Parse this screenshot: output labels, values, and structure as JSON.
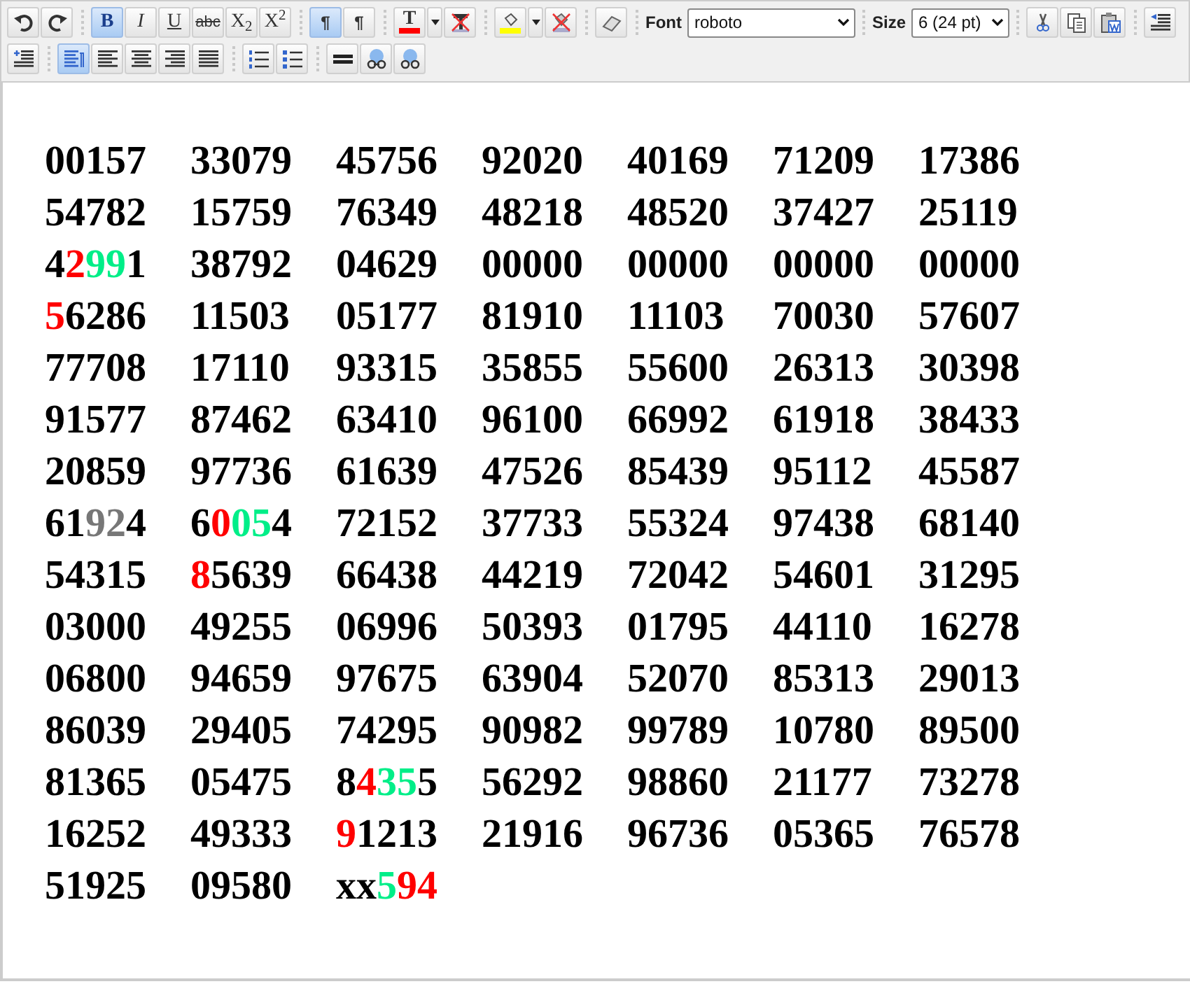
{
  "toolbar": {
    "rows": [
      [
        {
          "kind": "undo"
        },
        {
          "kind": "redo"
        },
        {
          "kind": "separator"
        },
        {
          "kind": "bold",
          "label": "B",
          "selected": true
        },
        {
          "kind": "italic",
          "label": "I",
          "selected": false
        },
        {
          "kind": "underline",
          "label": "U",
          "selected": false
        },
        {
          "kind": "strike",
          "label": "abc",
          "selected": false
        },
        {
          "kind": "script",
          "label": "X$_{2}$",
          "selected": false
        },
        {
          "kind": "script",
          "label": "X$^{2}$",
          "selected": false
        },
        {
          "kind": "separator"
        },
        {
          "kind": "ltr",
          "label": "¶",
          "selected": true
        },
        {
          "kind": "rtl",
          "label": "¶",
          "selected": false
        },
        {
          "kind": "separator"
        },
        {
          "kind": "forecolor",
          "label": "T",
          "color": "#ff0000"
        },
        {
          "kind": "caret"
        },
        {
          "kind": "remove-forecolor"
        },
        {
          "kind": "separator"
        },
        {
          "kind": "backcolor",
          "color": "#ffff00"
        },
        {
          "kind": "caret"
        },
        {
          "kind": "remove-backcolor"
        },
        {
          "kind": "separator"
        },
        {
          "kind": "eraser"
        },
        {
          "kind": "separator"
        },
        {
          "kind": "select",
          "label": "Font",
          "value": "roboto"
        },
        {
          "kind": "separator"
        },
        {
          "kind": "select",
          "label": "Size",
          "value": "6 (24 pt)"
        },
        {
          "kind": "separator"
        },
        {
          "kind": "cut"
        },
        {
          "kind": "copy"
        },
        {
          "kind": "paste-word"
        },
        {
          "kind": "separator"
        },
        {
          "kind": "outdent"
        }
      ],
      [
        {
          "kind": "indent"
        },
        {
          "kind": "separator"
        },
        {
          "kind": "align-para",
          "selected": true
        },
        {
          "kind": "align-left",
          "selected": false
        },
        {
          "kind": "align-center",
          "selected": false
        },
        {
          "kind": "align-right",
          "selected": false
        },
        {
          "kind": "align-justify",
          "selected": false
        },
        {
          "kind": "separator"
        },
        {
          "kind": "ordered-list"
        },
        {
          "kind": "bullet-list"
        },
        {
          "kind": "separator"
        },
        {
          "kind": "rule"
        },
        {
          "kind": "link"
        },
        {
          "kind": "unlink"
        }
      ]
    ]
  },
  "editor": {
    "rows": [
      [
        [
          {
            "text": "00157"
          }
        ],
        [
          {
            "text": "33079"
          }
        ],
        [
          {
            "text": "45756"
          }
        ],
        [
          {
            "text": "92020"
          }
        ],
        [
          {
            "text": "40169"
          }
        ],
        [
          {
            "text": "71209"
          }
        ],
        [
          {
            "text": "17386"
          }
        ]
      ],
      [
        [
          {
            "text": "54782"
          }
        ],
        [
          {
            "text": "15759"
          }
        ],
        [
          {
            "text": "76349"
          }
        ],
        [
          {
            "text": "48218"
          }
        ],
        [
          {
            "text": "48520"
          }
        ],
        [
          {
            "text": "37427"
          }
        ],
        [
          {
            "text": "25119"
          }
        ]
      ],
      [
        [
          {
            "text": "4"
          },
          {
            "text": "2",
            "color": "#ff0000"
          },
          {
            "text": "99",
            "color": "#00ee88"
          },
          {
            "text": "1"
          }
        ],
        [
          {
            "text": "38792"
          }
        ],
        [
          {
            "text": "04629"
          }
        ],
        [
          {
            "text": "00000"
          }
        ],
        [
          {
            "text": "00000"
          }
        ],
        [
          {
            "text": "00000"
          }
        ],
        [
          {
            "text": "00000"
          }
        ]
      ],
      [
        [
          {
            "text": "5",
            "color": "#ff0000"
          },
          {
            "text": "6286"
          }
        ],
        [
          {
            "text": "11503"
          }
        ],
        [
          {
            "text": "05177"
          }
        ],
        [
          {
            "text": "81910"
          }
        ],
        [
          {
            "text": "11103"
          }
        ],
        [
          {
            "text": "70030"
          }
        ],
        [
          {
            "text": "57607"
          }
        ]
      ],
      [
        [
          {
            "text": "77708"
          }
        ],
        [
          {
            "text": "17110"
          }
        ],
        [
          {
            "text": "93315"
          }
        ],
        [
          {
            "text": "35855"
          }
        ],
        [
          {
            "text": "55600"
          }
        ],
        [
          {
            "text": "26313"
          }
        ],
        [
          {
            "text": "30398"
          }
        ]
      ],
      [
        [
          {
            "text": "91577"
          }
        ],
        [
          {
            "text": "87462"
          }
        ],
        [
          {
            "text": "63410"
          }
        ],
        [
          {
            "text": "96100"
          }
        ],
        [
          {
            "text": "66992"
          }
        ],
        [
          {
            "text": "61918"
          }
        ],
        [
          {
            "text": "38433"
          }
        ]
      ],
      [
        [
          {
            "text": "20859"
          }
        ],
        [
          {
            "text": "97736"
          }
        ],
        [
          {
            "text": "61639"
          }
        ],
        [
          {
            "text": "47526"
          }
        ],
        [
          {
            "text": "85439"
          }
        ],
        [
          {
            "text": "95112"
          }
        ],
        [
          {
            "text": "45587"
          }
        ]
      ],
      [
        [
          {
            "text": "61"
          },
          {
            "text": "92",
            "color": "#777777"
          },
          {
            "text": "4"
          }
        ],
        [
          {
            "text": "6"
          },
          {
            "text": "0",
            "color": "#ff0000"
          },
          {
            "text": "05",
            "color": "#00ee88"
          },
          {
            "text": "4"
          }
        ],
        [
          {
            "text": "72152"
          }
        ],
        [
          {
            "text": "37733"
          }
        ],
        [
          {
            "text": "55324"
          }
        ],
        [
          {
            "text": "97438"
          }
        ],
        [
          {
            "text": "68140"
          }
        ]
      ],
      [
        [
          {
            "text": "54315"
          }
        ],
        [
          {
            "text": "8",
            "color": "#ff0000"
          },
          {
            "text": "5639"
          }
        ],
        [
          {
            "text": "66438"
          }
        ],
        [
          {
            "text": "44219"
          }
        ],
        [
          {
            "text": "72042"
          }
        ],
        [
          {
            "text": "54601"
          }
        ],
        [
          {
            "text": "31295"
          }
        ]
      ],
      [
        [
          {
            "text": "03000"
          }
        ],
        [
          {
            "text": "49255"
          }
        ],
        [
          {
            "text": "06996"
          }
        ],
        [
          {
            "text": "50393"
          }
        ],
        [
          {
            "text": "01795"
          }
        ],
        [
          {
            "text": "44110"
          }
        ],
        [
          {
            "text": "16278"
          }
        ]
      ],
      [
        [
          {
            "text": "06800"
          }
        ],
        [
          {
            "text": "94659"
          }
        ],
        [
          {
            "text": "97675"
          }
        ],
        [
          {
            "text": "63904"
          }
        ],
        [
          {
            "text": "52070"
          }
        ],
        [
          {
            "text": "85313"
          }
        ],
        [
          {
            "text": "29013"
          }
        ]
      ],
      [
        [
          {
            "text": "86039"
          }
        ],
        [
          {
            "text": "29405"
          }
        ],
        [
          {
            "text": "74295"
          }
        ],
        [
          {
            "text": "90982"
          }
        ],
        [
          {
            "text": "99789"
          }
        ],
        [
          {
            "text": "10780"
          }
        ],
        [
          {
            "text": "89500"
          }
        ]
      ],
      [
        [
          {
            "text": "81365"
          }
        ],
        [
          {
            "text": "05475"
          }
        ],
        [
          {
            "text": "8"
          },
          {
            "text": "4",
            "color": "#ff0000"
          },
          {
            "text": "35",
            "color": "#00ee88"
          },
          {
            "text": "5"
          }
        ],
        [
          {
            "text": "56292"
          }
        ],
        [
          {
            "text": "98860"
          }
        ],
        [
          {
            "text": "21177"
          }
        ],
        [
          {
            "text": "73278"
          }
        ]
      ],
      [
        [
          {
            "text": "16252"
          }
        ],
        [
          {
            "text": "49333"
          }
        ],
        [
          {
            "text": "9",
            "color": "#ff0000"
          },
          {
            "text": "1213"
          }
        ],
        [
          {
            "text": "21916"
          }
        ],
        [
          {
            "text": "96736"
          }
        ],
        [
          {
            "text": "05365"
          }
        ],
        [
          {
            "text": "76578"
          }
        ]
      ],
      [
        [
          {
            "text": "51925"
          }
        ],
        [
          {
            "text": "09580"
          }
        ],
        [
          {
            "text": "xx"
          },
          {
            "text": "5",
            "color": "#00ee88"
          },
          {
            "text": "94",
            "color": "#ff0000"
          }
        ]
      ]
    ]
  }
}
